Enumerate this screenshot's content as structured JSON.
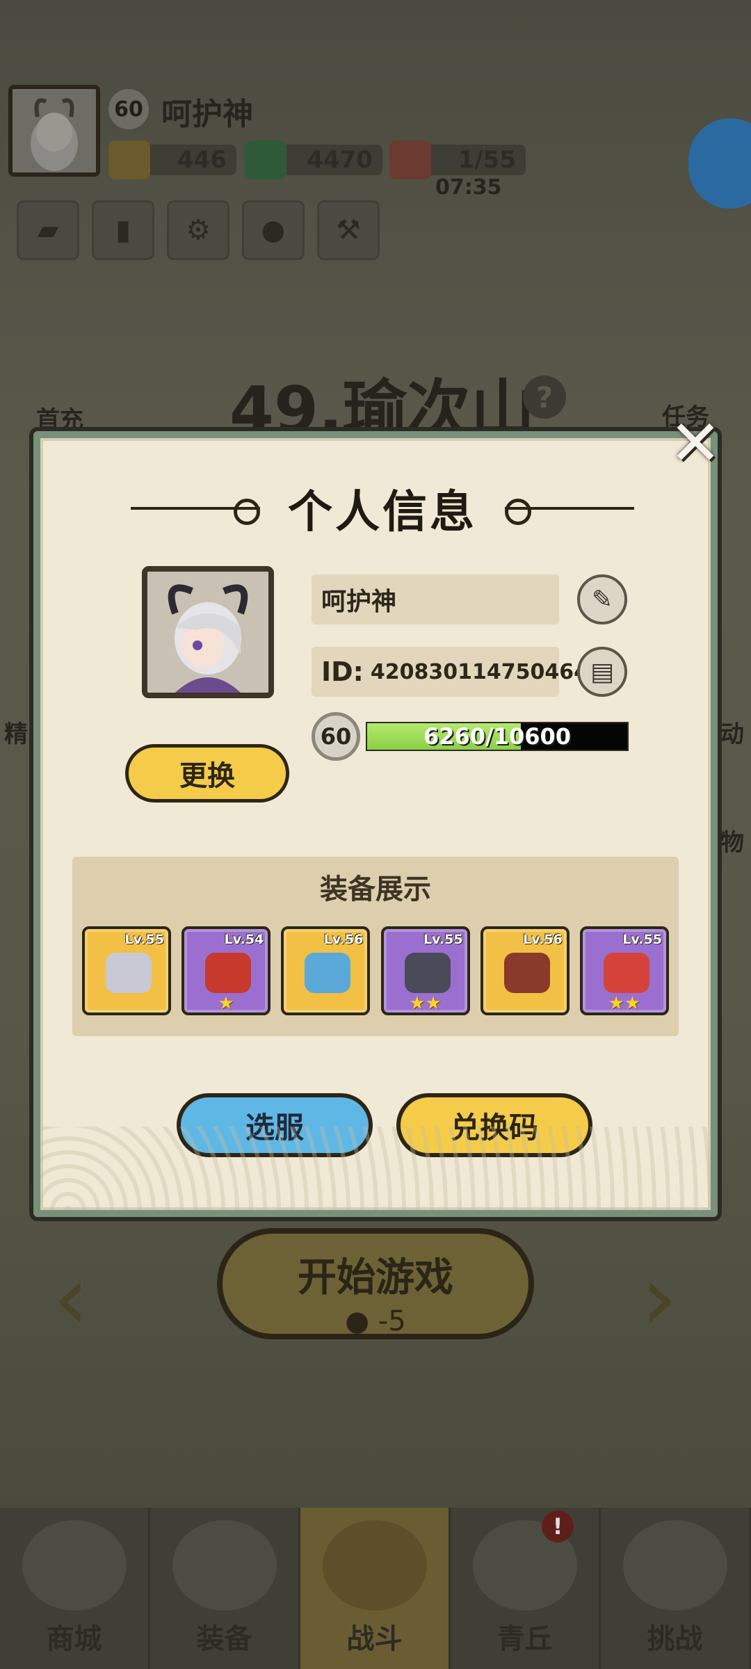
{
  "top_bar": {
    "level": "60",
    "player_name": "呵护神",
    "resources": [
      {
        "name": "gold",
        "icon": "gold-bag-icon",
        "value": "446"
      },
      {
        "name": "jade",
        "icon": "jade-dragon-icon",
        "value": "4470"
      },
      {
        "name": "peach",
        "icon": "peach-icon",
        "value": "1/55"
      }
    ],
    "timer": "07:35"
  },
  "stage": {
    "title": "49.瑜次山",
    "help_icon": "?"
  },
  "side_labels": {
    "first_recharge": "首充",
    "task": "任务",
    "left_mid": "精",
    "right_activity": "动",
    "right_gift": "物"
  },
  "start_button": {
    "label": "开始游戏",
    "cost": "-5"
  },
  "bottom_nav": [
    {
      "label": "商城",
      "icon": "shop-icon"
    },
    {
      "label": "装备",
      "icon": "armor-icon"
    },
    {
      "label": "战斗",
      "icon": "crossed-swords-icon"
    },
    {
      "label": "青丘",
      "icon": "mountain-icon",
      "badge": "!"
    },
    {
      "label": "挑战",
      "icon": "challenge-icon"
    }
  ],
  "modal": {
    "title": "个人信息",
    "close": "✕",
    "change_avatar": "更换",
    "name": "呵护神",
    "id_label": "ID:",
    "id_value": "420830114750464",
    "level": "60",
    "xp_text": "6260/10600",
    "xp_fraction": 0.5906,
    "equip_title": "装备展示",
    "equipment": [
      {
        "lv": "Lv.55",
        "rarity": "gold",
        "stars": "",
        "item_color": "#c9c9d6"
      },
      {
        "lv": "Lv.54",
        "rarity": "purple",
        "stars": "★",
        "item_color": "#c7382d"
      },
      {
        "lv": "Lv.56",
        "rarity": "gold",
        "stars": "",
        "item_color": "#5aa9d8"
      },
      {
        "lv": "Lv.55",
        "rarity": "purple",
        "stars": "★★",
        "item_color": "#4a4a58"
      },
      {
        "lv": "Lv.56",
        "rarity": "gold",
        "stars": "",
        "item_color": "#8a3a2a"
      },
      {
        "lv": "Lv.55",
        "rarity": "purple",
        "stars": "★★",
        "item_color": "#d5423a"
      }
    ],
    "server_button": "选服",
    "code_button": "兑换码"
  },
  "colors": {
    "modal_bg": "#f0e9d6",
    "modal_border": "#77917b",
    "yellow_button": "#f4cc4a",
    "blue_button": "#5fb7e6",
    "xp_fill": "#8bcf45"
  }
}
